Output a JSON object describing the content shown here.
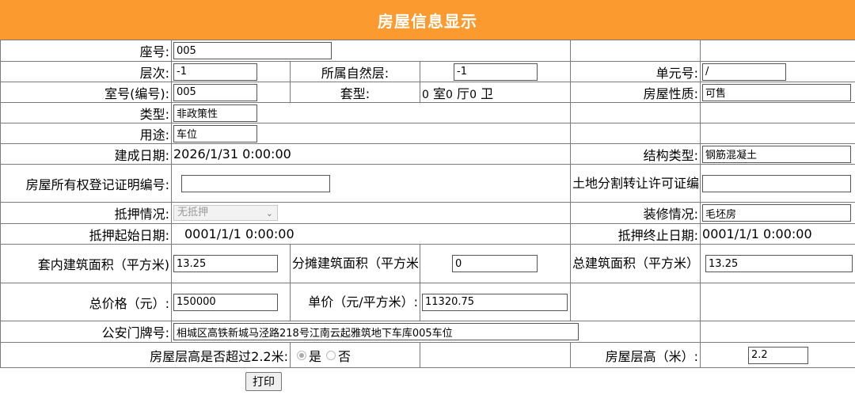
{
  "header": {
    "title": "房屋信息显示"
  },
  "fields": {
    "seat_no": {
      "label": "座号:",
      "value": "005"
    },
    "floor": {
      "label": "层次:",
      "value": "-1"
    },
    "natural_floor": {
      "label": "所属自然层:",
      "value": "-1"
    },
    "unit_no": {
      "label": "单元号:",
      "value": "/"
    },
    "room_no": {
      "label": "室号(编号):",
      "value": "005"
    },
    "layout": {
      "label": "套型:",
      "room": "0",
      "room_unit": "室",
      "hall": "0",
      "hall_unit": "厅",
      "bath": "0",
      "bath_unit": "卫"
    },
    "house_nature": {
      "label": "房屋性质:",
      "value": "可售"
    },
    "type": {
      "label": "类型:",
      "value": "非政策性"
    },
    "usage": {
      "label": "用途:",
      "value": "车位"
    },
    "built_date": {
      "label": "建成日期:",
      "value": "2026/1/31 0:00:00"
    },
    "structure_type": {
      "label": "结构类型:",
      "value": "钢筋混凝土"
    },
    "ownership_cert": {
      "label": "房屋所有权登记证明编号:",
      "value": ""
    },
    "land_permit": {
      "label": "土地分割转让许可证编号:",
      "value": ""
    },
    "mortgage": {
      "label": "抵押情况:",
      "value": "无抵押"
    },
    "decoration": {
      "label": "装修情况:",
      "value": "毛坯房"
    },
    "mortgage_start": {
      "label": "抵押起始日期:",
      "value": "0001/1/1 0:00:00"
    },
    "mortgage_end": {
      "label": "抵押终止日期:",
      "value": "0001/1/1 0:00:00"
    },
    "inner_area": {
      "label": "套内建筑面积（平方米)",
      "value": "13.25"
    },
    "shared_area": {
      "label": "分摊建筑面积（平方米）:",
      "value": "0"
    },
    "total_area": {
      "label": "总建筑面积（平方米）:",
      "value": "13.25"
    },
    "total_price": {
      "label": "总价格（元）:",
      "value": "150000"
    },
    "unit_price": {
      "label": "单价（元/平方米）:",
      "value": "11320.75"
    },
    "address": {
      "label": "公安门牌号:",
      "value": "相城区高铁新城马泾路218号江南云起雅筑地下车库005车位"
    },
    "height_over": {
      "label": "房屋层高是否超过2.2米:",
      "yes": "是",
      "no": "否",
      "selected": "是"
    },
    "floor_height": {
      "label": "房屋层高（米）:",
      "value": "2.2"
    }
  },
  "actions": {
    "print_label": "打印"
  }
}
